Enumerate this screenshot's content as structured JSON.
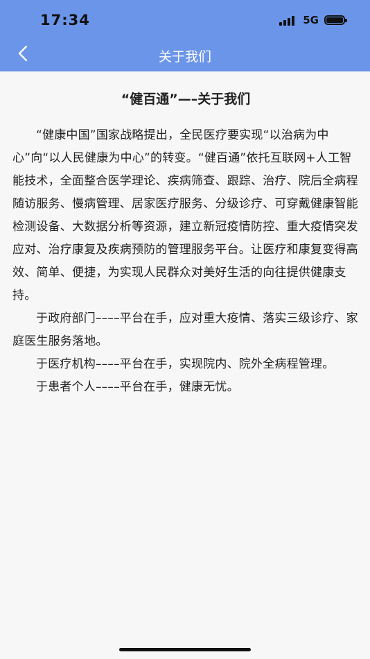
{
  "status_bar": {
    "time": "17:34",
    "network": "5G"
  },
  "nav": {
    "title": "关于我们",
    "back_label": "返回"
  },
  "content": {
    "heading": "“健百通”—–关于我们",
    "paragraphs": [
      "“健康中国”国家战略提出，全民医疗要实现“以治病为中心”向“以人民健康为中心”的转变。“健百通”依托互联网+人工智能技术，全面整合医学理论、疾病筛查、跟踪、治疗、院后全病程随访服务、慢病管理、居家医疗服务、分级诊疗、可穿戴健康智能检测设备、大数据分析等资源，建立新冠疫情防控、重大疫情突发应对、治疗康复及疾病预防的管理服务平台。让医疗和康复变得高效、简单、便捷，为实现人民群众对美好生活的向往提供健康支持。",
      "于政府部门––––平台在手，应对重大疫情、落实三级诊疗、家庭医生服务落地。",
      "于医疗机构––––平台在手，实现院内、院外全病程管理。",
      "于患者个人––––平台在手，健康无忧。"
    ]
  },
  "colors": {
    "header": "#6b95e8",
    "background": "#f7f7f7"
  }
}
